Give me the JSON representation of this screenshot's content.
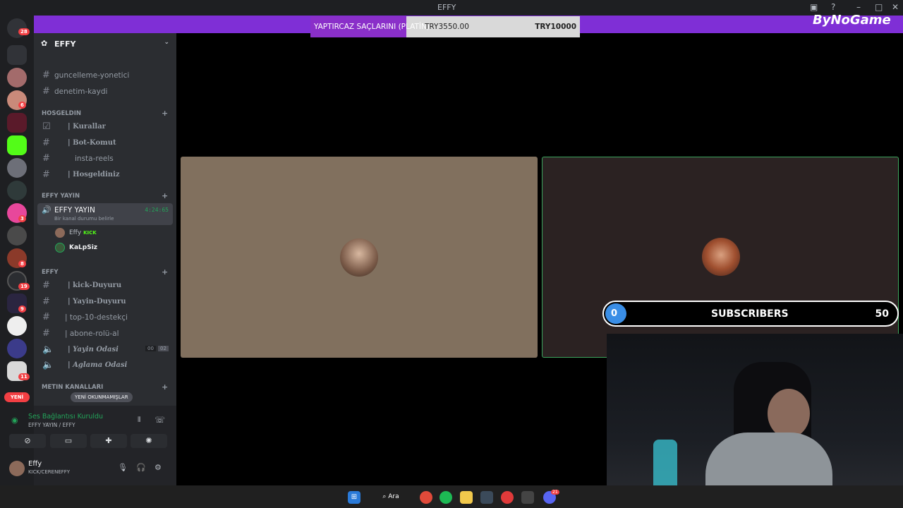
{
  "window": {
    "title": "EFFY"
  },
  "rail": {
    "home_badge": "28",
    "badges": [
      "6",
      "3",
      "8",
      "19",
      "9",
      "11"
    ],
    "new_label": "YENİ"
  },
  "guild": {
    "name": "EFFY"
  },
  "channels": {
    "top": [
      "guncelleme-yonetici",
      "denetim-kaydi"
    ],
    "cat1": {
      "name": "HOSGELDIN",
      "items": [
        "| Kurallar",
        "| Bot-Komut",
        "insta-reels",
        "| Hosgeldiniz"
      ]
    },
    "cat2": {
      "name": "EFFY YAYIN"
    },
    "voice": {
      "name": "EFFY YAYIN",
      "status": "Bir kanal durumu belirle",
      "timer": "4:24:65"
    },
    "voice_users": [
      {
        "name": "Effy",
        "tag": "KICK"
      },
      {
        "name": "KaLpSiz"
      }
    ],
    "cat3": {
      "name": "EFFY",
      "items": [
        "| kick-Duyuru",
        "| Yayin-Duyuru",
        "| top-10-destekçi",
        "| abone-rolü-al",
        "| Yayin Odasi",
        "| Aglama Odasi"
      ]
    },
    "yayin_counts": [
      "00",
      "02"
    ],
    "cat4": {
      "name": "METIN KANALLARI"
    }
  },
  "unread_pill": "YENİ OKUNMAMIŞLAR",
  "voice_panel": {
    "status": "Ses Bağlantısı Kuruldu",
    "sub": "EFFY YAYIN / EFFY"
  },
  "user_panel": {
    "name": "Effy",
    "sub": "KICK/CERENEFFY"
  },
  "donation": {
    "title": "YAPTIRCAZ SAÇLARINI (PLATİN)",
    "current": "TRY3550.00",
    "target": "TRY10000",
    "progress_fraction": 0.355
  },
  "brand": "ByNoGame",
  "subscribers": {
    "start": "0",
    "label": "SUBSCRIBERS",
    "goal": "50"
  },
  "taskbar": {
    "search": "Ara",
    "discord_badge": "21"
  }
}
